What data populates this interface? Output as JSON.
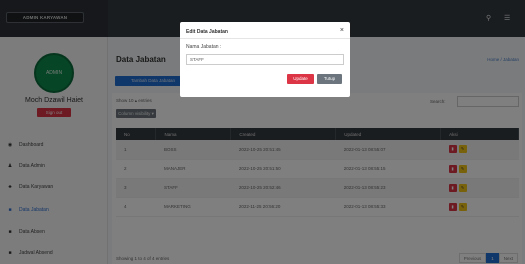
{
  "brand": "ADMIN KARYAWAN",
  "header": {
    "search_icon": "search-icon",
    "menu_icon": "hamburger-icon"
  },
  "sidebar": {
    "avatar_text": "ADMIN",
    "user_name": "Moch Dzawil Haiet",
    "logout_label": "Sign out",
    "items": [
      {
        "label": "Dashboard",
        "icon": "dashboard-icon",
        "glyph": "◉",
        "active": false
      },
      {
        "label": "Data Admin",
        "icon": "user-icon",
        "glyph": "♟",
        "active": false
      },
      {
        "label": "Data Karyawan",
        "icon": "users-icon",
        "glyph": "♣",
        "active": false
      },
      {
        "label": "Data Jabatan",
        "icon": "bookmark-icon",
        "glyph": "■",
        "active": true
      },
      {
        "label": "Data Absen",
        "icon": "list-icon",
        "glyph": "■",
        "active": false
      },
      {
        "label": "Jadwal Absend",
        "icon": "calendar-icon",
        "glyph": "■",
        "active": false
      }
    ]
  },
  "main": {
    "title": "Data Jabatan",
    "breadcrumb": "Home / Jabatan",
    "add_button": "Tambah Data Jabatan",
    "show_entries": "Show 10 ▴ entries",
    "column_visibility": "Column visibility ▾",
    "search_label": "Search:",
    "table": {
      "headers": [
        "No",
        "Nama",
        "Created",
        "Updated",
        "Aksi"
      ],
      "rows": [
        {
          "no": "1",
          "nama": "BOSS",
          "created": "2022-10-25 20:51:45",
          "updated": "2022-01-13 08:55:07"
        },
        {
          "no": "2",
          "nama": "MANAJER",
          "created": "2022-10-25 20:51:50",
          "updated": "2022-01-13 08:55:15"
        },
        {
          "no": "3",
          "nama": "STAFF",
          "created": "2022-10-25 20:52:46",
          "updated": "2022-01-13 08:55:23"
        },
        {
          "no": "4",
          "nama": "MARKETING",
          "created": "2022-11-25 20:56:20",
          "updated": "2022-01-13 08:55:33"
        }
      ]
    },
    "showing": "Showing 1 to 4 of 4 entries",
    "pagination": {
      "prev": "Previous",
      "current": "1",
      "next": "Next"
    }
  },
  "modal": {
    "title": "Edit Data Jabatan",
    "close": "×",
    "field_label": "Nama Jabatan :",
    "field_value": "STAFF",
    "update_label": "Update",
    "close_label": "Tutup"
  },
  "colors": {
    "sidebar_active": "#2f6fcf",
    "primary": "#1f6ed4",
    "danger": "#dc3545",
    "warning": "#f0c419",
    "topbar": "#343a40"
  }
}
